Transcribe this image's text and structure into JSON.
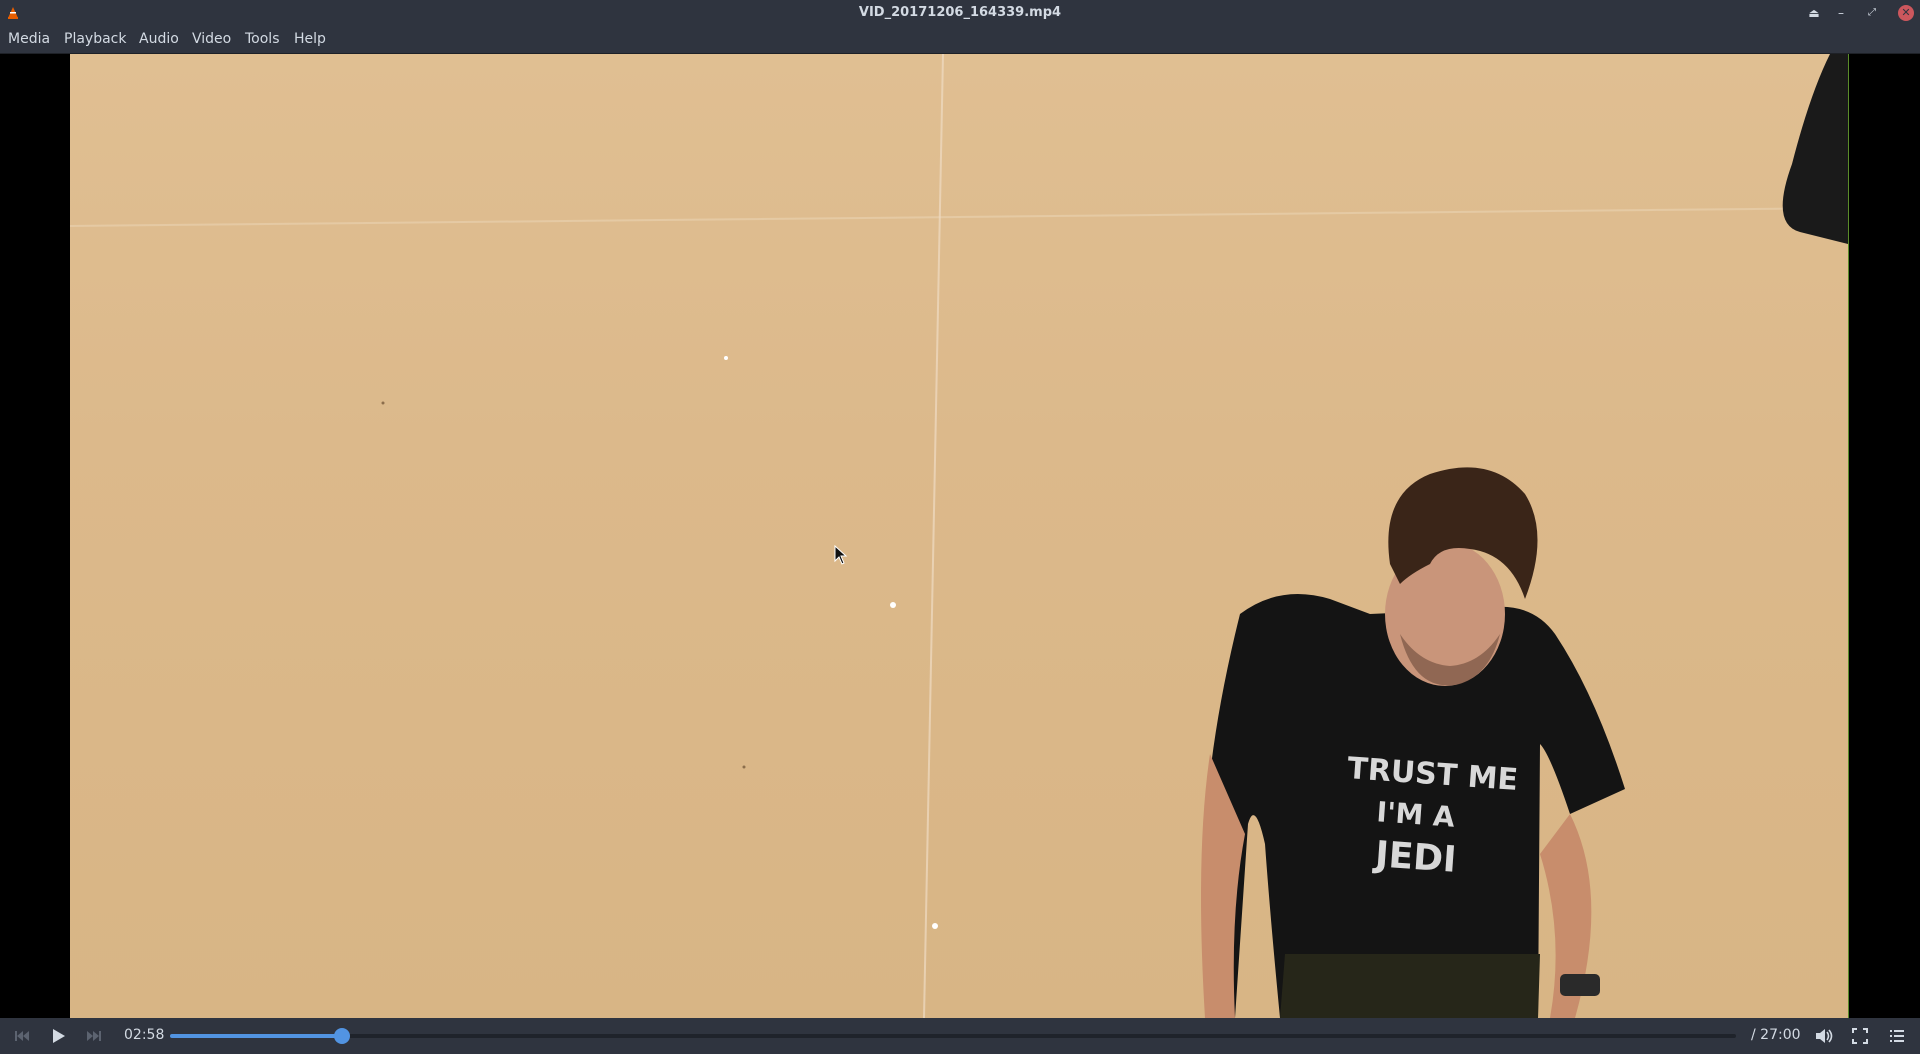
{
  "window": {
    "title": "VID_20171206_164339.mp4"
  },
  "menu": {
    "items": [
      {
        "label": "Media"
      },
      {
        "label": "Playback"
      },
      {
        "label": "Audio"
      },
      {
        "label": "Video"
      },
      {
        "label": "Tools"
      },
      {
        "label": "Help"
      }
    ]
  },
  "video": {
    "shirt_text": "TRUST ME I'M A JEDI"
  },
  "controls": {
    "current_time": "02:58",
    "total_time": "/ 27:00",
    "progress": 0.11,
    "icons": {
      "prev": "skip-back-icon",
      "play": "play-icon",
      "next": "skip-forward-icon",
      "volume": "volume-icon",
      "fullscreen": "fullscreen-icon",
      "playlist": "playlist-icon"
    }
  },
  "colors": {
    "chrome": "#2f343f",
    "accent": "#5294e2",
    "text": "#d3dae3",
    "close": "#cc575d"
  }
}
